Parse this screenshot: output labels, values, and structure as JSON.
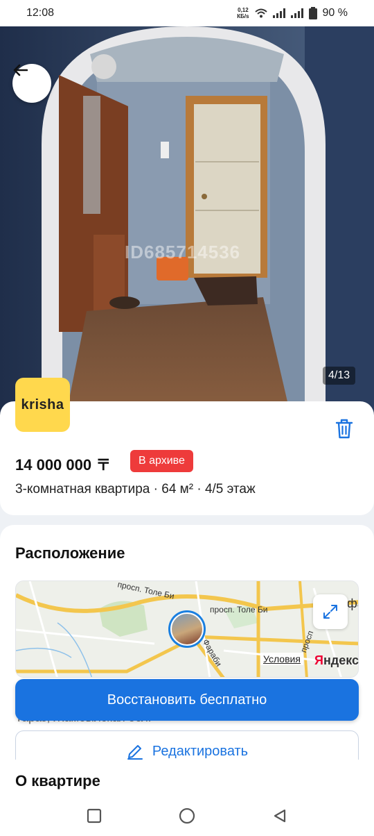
{
  "status_bar": {
    "time": "12:08",
    "net_speed_value": "0,12",
    "net_speed_unit": "КБ/s",
    "battery": "90 %",
    "icons": [
      "wifi-icon",
      "signal-icon",
      "signal-icon",
      "battery-icon"
    ]
  },
  "photo": {
    "watermark": "ID685714536",
    "counter": "4/13"
  },
  "listing": {
    "logo_text": "krisha",
    "price": "14 000 000 〒",
    "status_badge": "В архиве",
    "description": "3-комнатная квартира · 64 м² · 4/5 этаж"
  },
  "location": {
    "title": "Расположение",
    "map_labels": {
      "street1": "просп. Толе Би",
      "street2": "просп. Толе Би",
      "street3": "Фараби",
      "street4": "просп",
      "edge": "фа"
    },
    "terms_link": "Условия",
    "map_brand": "Яндекс",
    "address_partial": "Тараз, Жамбылская обл."
  },
  "actions": {
    "restore_label": "Восстановить бесплатно",
    "edit_label": "Редактировать"
  },
  "about": {
    "title": "О квартире"
  },
  "colors": {
    "accent": "#1a73e0",
    "archive_badge": "#ee3b3b",
    "logo_bg": "#ffd84d"
  }
}
